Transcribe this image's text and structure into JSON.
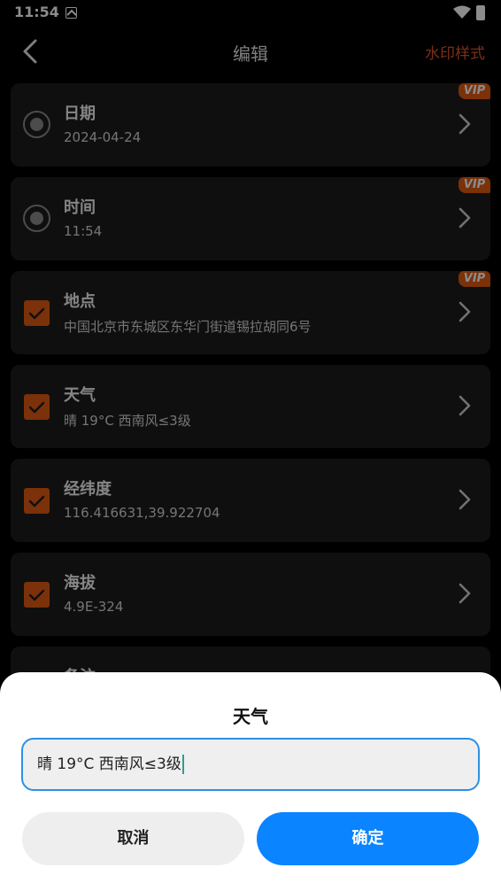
{
  "status_bar": {
    "time": "11:54"
  },
  "header": {
    "title": "编辑",
    "watermark_style": "水印样式"
  },
  "rows": [
    {
      "title": "日期",
      "value": "2024-04-24",
      "control": "radio",
      "vip": true
    },
    {
      "title": "时间",
      "value": "11:54",
      "control": "radio",
      "vip": true
    },
    {
      "title": "地点",
      "value": "中国北京市东城区东华门街道锡拉胡同6号",
      "control": "checkbox",
      "vip": true
    },
    {
      "title": "天气",
      "value": "晴 19°C 西南风≤3级",
      "control": "checkbox",
      "vip": false
    },
    {
      "title": "经纬度",
      "value": "116.416631,39.922704",
      "control": "checkbox",
      "vip": false
    },
    {
      "title": "海拔",
      "value": "4.9E-324",
      "control": "checkbox",
      "vip": false
    },
    {
      "title": "备注",
      "value": "",
      "control": "checkbox",
      "vip": false
    }
  ],
  "vip_label": "VIP",
  "dialog": {
    "title": "天气",
    "input_value": "晴 19°C 西南风≤3级",
    "cancel": "取消",
    "confirm": "确定"
  },
  "colors": {
    "accent": "#e05a12",
    "primary_button": "#0a84ff",
    "input_border": "#2f8fe6"
  }
}
